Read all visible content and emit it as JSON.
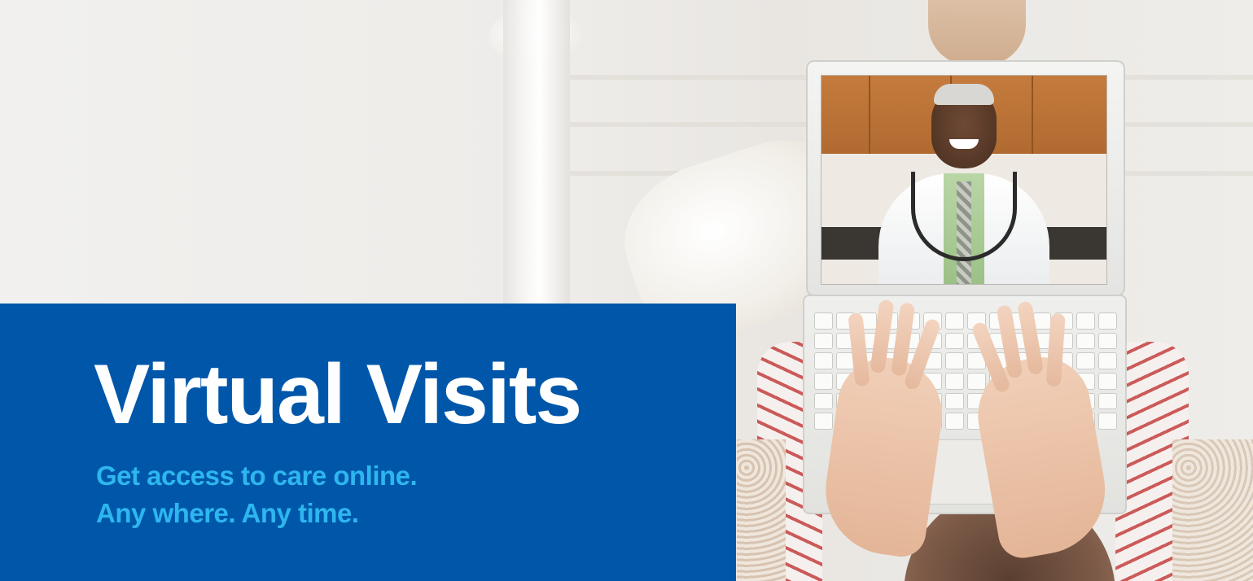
{
  "banner": {
    "title": "Virtual Visits",
    "subtitle_line1": "Get access to care online.",
    "subtitle_line2": "Any where. Any time."
  },
  "colors": {
    "panel_blue": "#0057aa",
    "title_white": "#ffffff",
    "subtitle_cyan": "#2eb6ee"
  }
}
